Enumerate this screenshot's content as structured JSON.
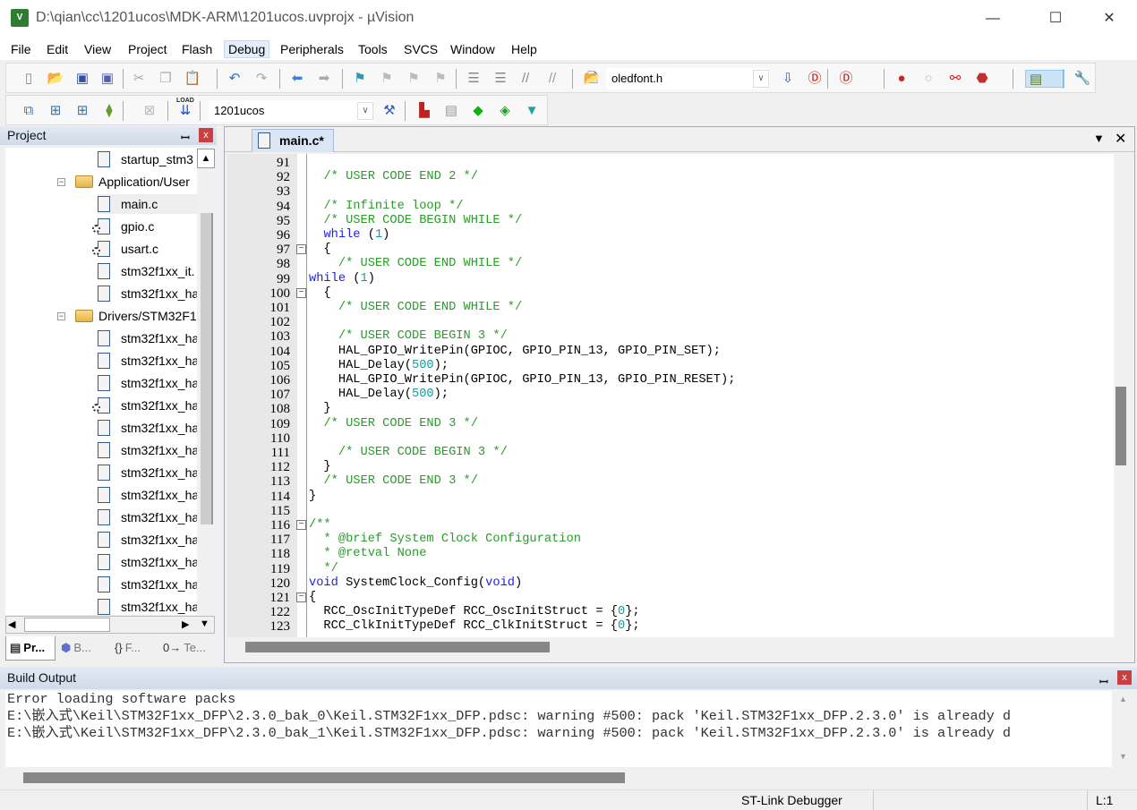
{
  "window": {
    "title": "D:\\qian\\cc\\1201ucos\\MDK-ARM\\1201ucos.uvprojx - µVision",
    "icon": "uv-app-icon",
    "minimize": "—",
    "maximize": "☐",
    "close": "✕"
  },
  "menu": [
    "File",
    "Edit",
    "View",
    "Project",
    "Flash",
    "Debug",
    "Peripherals",
    "Tools",
    "SVCS",
    "Window",
    "Help"
  ],
  "menu_active": "Debug",
  "toolbar1": {
    "find_combo": "oledfont.h",
    "icons": [
      "new-file",
      "open-file",
      "save",
      "save-all",
      "cut",
      "copy",
      "paste",
      "undo",
      "redo",
      "navigate-back",
      "navigate-forward",
      "bookmark",
      "prev-bookmark",
      "next-bookmark",
      "clear-bookmarks",
      "indent",
      "unindent",
      "comment",
      "uncomment",
      "find-in-files",
      "find",
      "incremental-find",
      "debug-start",
      "breakpoint-insert",
      "breakpoint-enable",
      "breakpoint-disable",
      "breakpoint-kill",
      "window-layout",
      "configure"
    ]
  },
  "toolbar2": {
    "target_combo": "1201ucos",
    "load_label": "LOAD",
    "icons": [
      "translate",
      "build",
      "rebuild",
      "batch-build",
      "stop-build",
      "download",
      "target-options",
      "manage-components",
      "select-packs",
      "pack-installer",
      "manage-run-time"
    ]
  },
  "project_panel": {
    "title": "Project",
    "pin": "ㅁ",
    "close": "x",
    "tree": [
      {
        "label": "startup_stm3",
        "type": "file",
        "level": 2
      },
      {
        "label": "Application/User",
        "type": "folder",
        "level": 1
      },
      {
        "label": "main.c",
        "type": "file",
        "level": 2,
        "selected": true
      },
      {
        "label": "gpio.c",
        "type": "file-gear",
        "level": 2
      },
      {
        "label": "usart.c",
        "type": "file-gear",
        "level": 2
      },
      {
        "label": "stm32f1xx_it.",
        "type": "file",
        "level": 2
      },
      {
        "label": "stm32f1xx_ha",
        "type": "file",
        "level": 2
      },
      {
        "label": "Drivers/STM32F1",
        "type": "folder",
        "level": 1
      },
      {
        "label": "stm32f1xx_ha",
        "type": "file",
        "level": 2
      },
      {
        "label": "stm32f1xx_ha",
        "type": "file",
        "level": 2
      },
      {
        "label": "stm32f1xx_ha",
        "type": "file",
        "level": 2
      },
      {
        "label": "stm32f1xx_ha",
        "type": "file-gear",
        "level": 2
      },
      {
        "label": "stm32f1xx_ha",
        "type": "file",
        "level": 2
      },
      {
        "label": "stm32f1xx_ha",
        "type": "file",
        "level": 2
      },
      {
        "label": "stm32f1xx_ha",
        "type": "file",
        "level": 2
      },
      {
        "label": "stm32f1xx_ha",
        "type": "file",
        "level": 2
      },
      {
        "label": "stm32f1xx_ha",
        "type": "file",
        "level": 2
      },
      {
        "label": "stm32f1xx_ha",
        "type": "file",
        "level": 2
      },
      {
        "label": "stm32f1xx_ha",
        "type": "file",
        "level": 2
      },
      {
        "label": "stm32f1xx_ha",
        "type": "file",
        "level": 2
      },
      {
        "label": "stm32f1xx_ha",
        "type": "file",
        "level": 2
      }
    ],
    "tabs": [
      {
        "label": "Pr...",
        "icon": "project-icon"
      },
      {
        "label": "B...",
        "icon": "books-icon"
      },
      {
        "label": "F...",
        "icon": "functions-icon"
      },
      {
        "label": "Te...",
        "icon": "templates-icon"
      }
    ]
  },
  "editor": {
    "tab": "main.c*",
    "lines": [
      {
        "n": "91",
        "s": []
      },
      {
        "n": "92",
        "s": [
          [
            "  ",
            ""
          ],
          [
            "/* USER CODE END 2 */",
            "cm"
          ]
        ]
      },
      {
        "n": "93",
        "s": []
      },
      {
        "n": "94",
        "s": [
          [
            "  ",
            ""
          ],
          [
            "/* Infinite loop */",
            "cm"
          ]
        ]
      },
      {
        "n": "95",
        "s": [
          [
            "  ",
            ""
          ],
          [
            "/* USER CODE BEGIN WHILE */",
            "cm"
          ]
        ]
      },
      {
        "n": "96",
        "s": [
          [
            "  ",
            ""
          ],
          [
            "while",
            "kw"
          ],
          [
            " (",
            ""
          ],
          [
            "1",
            "nm"
          ],
          [
            ")",
            ""
          ]
        ]
      },
      {
        "n": "97",
        "fold": true,
        "s": [
          [
            "  {",
            ""
          ]
        ]
      },
      {
        "n": "98",
        "s": [
          [
            "    ",
            ""
          ],
          [
            "/* USER CODE END WHILE */",
            "cm"
          ]
        ]
      },
      {
        "n": "99",
        "s": [
          [
            "while",
            "kw"
          ],
          [
            " (",
            ""
          ],
          [
            "1",
            "nm"
          ],
          [
            ")",
            ""
          ]
        ]
      },
      {
        "n": "100",
        "fold": true,
        "s": [
          [
            "  {",
            ""
          ]
        ]
      },
      {
        "n": "101",
        "s": [
          [
            "    ",
            ""
          ],
          [
            "/* USER CODE END WHILE */",
            "cm"
          ]
        ]
      },
      {
        "n": "102",
        "s": []
      },
      {
        "n": "103",
        "s": [
          [
            "    ",
            ""
          ],
          [
            "/* USER CODE BEGIN 3 */",
            "cm"
          ]
        ]
      },
      {
        "n": "104",
        "s": [
          [
            "    HAL_GPIO_WritePin(GPIOC, GPIO_PIN_13, GPIO_PIN_SET);",
            ""
          ]
        ]
      },
      {
        "n": "105",
        "s": [
          [
            "    HAL_Delay(",
            ""
          ],
          [
            "500",
            "nm"
          ],
          [
            ");",
            ""
          ]
        ]
      },
      {
        "n": "106",
        "s": [
          [
            "    HAL_GPIO_WritePin(GPIOC, GPIO_PIN_13, GPIO_PIN_RESET);",
            ""
          ]
        ]
      },
      {
        "n": "107",
        "s": [
          [
            "    HAL_Delay(",
            ""
          ],
          [
            "500",
            "nm"
          ],
          [
            ");",
            ""
          ]
        ]
      },
      {
        "n": "108",
        "s": [
          [
            "  }",
            ""
          ]
        ]
      },
      {
        "n": "109",
        "s": [
          [
            "  ",
            ""
          ],
          [
            "/* USER CODE END 3 */",
            "cm"
          ]
        ]
      },
      {
        "n": "110",
        "s": []
      },
      {
        "n": "111",
        "s": [
          [
            "    ",
            ""
          ],
          [
            "/* USER CODE BEGIN 3 */",
            "cm"
          ]
        ]
      },
      {
        "n": "112",
        "s": [
          [
            "  }",
            ""
          ]
        ]
      },
      {
        "n": "113",
        "s": [
          [
            "  ",
            ""
          ],
          [
            "/* USER CODE END 3 */",
            "cm"
          ]
        ]
      },
      {
        "n": "114",
        "s": [
          [
            "}",
            ""
          ]
        ]
      },
      {
        "n": "115",
        "s": []
      },
      {
        "n": "116",
        "fold": true,
        "s": [
          [
            "/**",
            "cm"
          ]
        ]
      },
      {
        "n": "117",
        "s": [
          [
            "  ",
            ""
          ],
          [
            "* @brief System Clock Configuration",
            "cm"
          ]
        ]
      },
      {
        "n": "118",
        "s": [
          [
            "  ",
            ""
          ],
          [
            "* @retval None",
            "cm"
          ]
        ]
      },
      {
        "n": "119",
        "s": [
          [
            "  ",
            ""
          ],
          [
            "*/",
            "cm"
          ]
        ]
      },
      {
        "n": "120",
        "s": [
          [
            "void",
            "kw"
          ],
          [
            " SystemClock_Config(",
            ""
          ],
          [
            "void",
            "kw"
          ],
          [
            ")",
            ""
          ]
        ]
      },
      {
        "n": "121",
        "fold": true,
        "s": [
          [
            "{",
            ""
          ]
        ]
      },
      {
        "n": "122",
        "s": [
          [
            "  RCC_OscInitTypeDef RCC_OscInitStruct = {",
            ""
          ],
          [
            "0",
            "nm"
          ],
          [
            "};",
            ""
          ]
        ]
      },
      {
        "n": "123",
        "s": [
          [
            "  RCC_ClkInitTypeDef RCC_ClkInitStruct = {",
            ""
          ],
          [
            "0",
            "nm"
          ],
          [
            "};",
            ""
          ]
        ]
      }
    ],
    "dropdown": "▼",
    "close": "✕"
  },
  "build_output": {
    "title": "Build Output",
    "pin": "ㅁ",
    "close": "x",
    "lines": [
      "Error loading software packs",
      "E:\\嵌入式\\Keil\\STM32F1xx_DFP\\2.3.0_bak_0\\Keil.STM32F1xx_DFP.pdsc: warning #500: pack 'Keil.STM32F1xx_DFP.2.3.0' is already d",
      "E:\\嵌入式\\Keil\\STM32F1xx_DFP\\2.3.0_bak_1\\Keil.STM32F1xx_DFP.pdsc: warning #500: pack 'Keil.STM32F1xx_DFP.2.3.0' is already d"
    ]
  },
  "status": {
    "debugger": "ST-Link Debugger",
    "position": "L:1"
  },
  "colors": {
    "comment": "#2b9b2b",
    "keyword": "#1e1ee8",
    "number": "#1a9a9a",
    "close_red": "#c94040"
  }
}
